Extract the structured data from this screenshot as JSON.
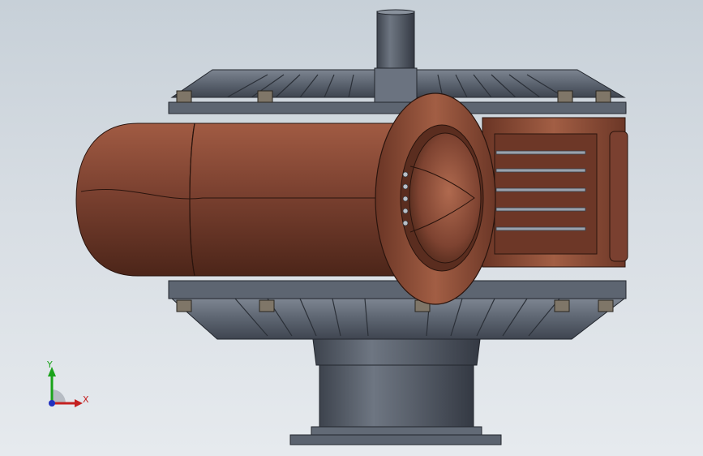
{
  "viewport": {
    "background_top": "#c7d0d8",
    "background_bottom": "#e6eaee"
  },
  "model": {
    "copper_color": "#8a4a35",
    "steel_color": "#5c6470"
  },
  "triad": {
    "x_label": "X",
    "y_label": "Y",
    "x_color": "#c42020",
    "y_color": "#1aa31a",
    "z_color": "#2030c0"
  }
}
